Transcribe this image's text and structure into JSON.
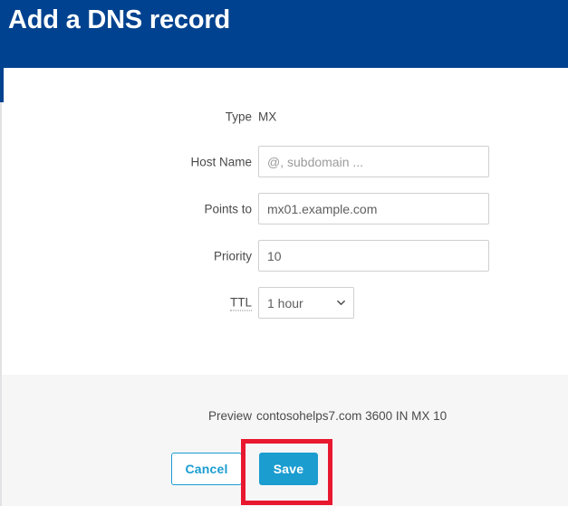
{
  "header": {
    "title": "Add a DNS record",
    "background_color": "#00428f"
  },
  "form": {
    "rows": [
      {
        "label": "Type",
        "kind": "static",
        "value": "MX"
      },
      {
        "label": "Host Name",
        "kind": "input",
        "value": "",
        "placeholder": "@, subdomain ..."
      },
      {
        "label": "Points to",
        "kind": "input",
        "value": "mx01.example.com",
        "placeholder": ""
      },
      {
        "label": "Priority",
        "kind": "input",
        "value": "10",
        "placeholder": ""
      },
      {
        "label": "TTL",
        "kind": "select",
        "value": "1 hour",
        "tooltip": true
      }
    ],
    "ttl_options": [
      "1 hour"
    ]
  },
  "footer": {
    "preview_label": "Preview",
    "preview_value": "contosohelps7.com  3600  IN  MX  10",
    "cancel_label": "Cancel",
    "save_label": "Save",
    "save_color": "#1b9dd0"
  },
  "annotation": {
    "highlight_color": "#e8182f",
    "target": "save-button"
  },
  "icons": {
    "chevron_down": "chevron-down-icon"
  }
}
